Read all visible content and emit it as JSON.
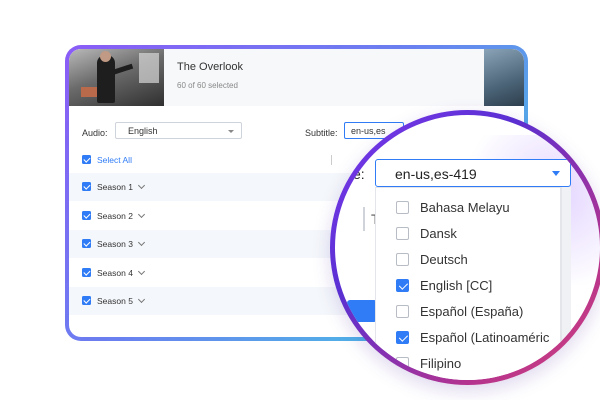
{
  "header": {
    "title": "The Overlook",
    "selected_count": "60 of 60 selected"
  },
  "controls": {
    "audio_label": "Audio:",
    "audio_value": "English",
    "subtitle_label": "Subtitle:",
    "subtitle_value": "en-us,es"
  },
  "select_all": "Select All",
  "seasons": [
    {
      "label": "Season 1",
      "checked": true
    },
    {
      "label": "Season 2",
      "checked": true
    },
    {
      "label": "Season 3",
      "checked": true
    },
    {
      "label": "Season 4",
      "checked": true
    },
    {
      "label": "Season 5",
      "checked": true
    }
  ],
  "magnifier": {
    "label_fragment": "e:",
    "subtitle_select_value": "en-us,es-419",
    "side_fragment": "T",
    "options": [
      {
        "label": "Bahasa Melayu",
        "checked": false
      },
      {
        "label": "Dansk",
        "checked": false
      },
      {
        "label": "Deutsch",
        "checked": false
      },
      {
        "label": "English [CC]",
        "checked": true
      },
      {
        "label": "Español (España)",
        "checked": false
      },
      {
        "label": "Español (Latinoaméric",
        "checked": true
      },
      {
        "label": "Filipino",
        "checked": false
      }
    ]
  },
  "colors": {
    "accent": "#2f7cf6",
    "frame_gradient_start": "#8a5cf6",
    "frame_gradient_end": "#3ed3e0",
    "magnifier_ring_start": "#7c3aed",
    "magnifier_ring_end": "#d8447a"
  }
}
